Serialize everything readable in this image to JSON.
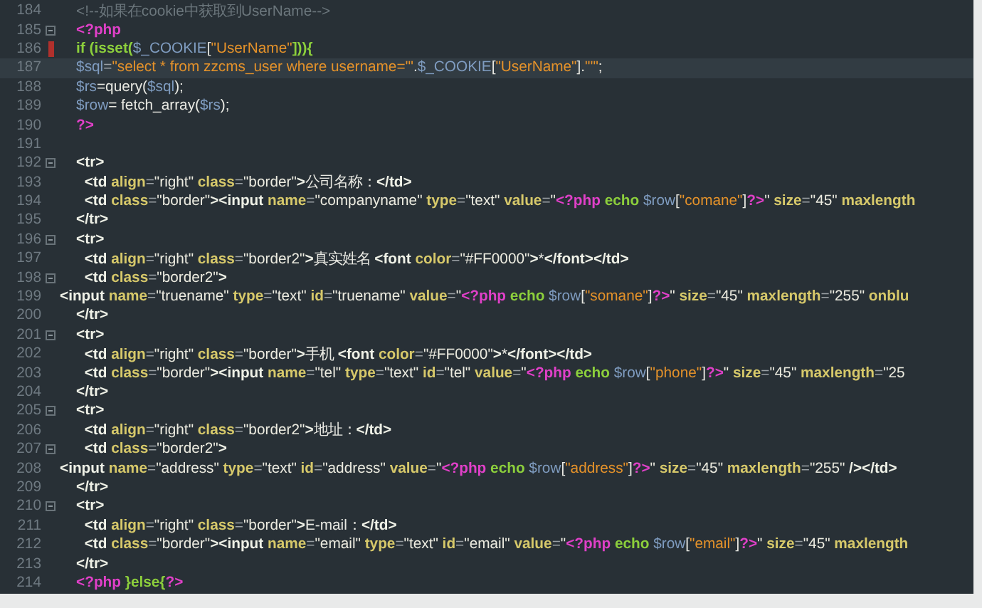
{
  "editor": {
    "lines": [
      {
        "number": "184",
        "fold": false,
        "marker": false,
        "current": false,
        "tokens": [
          {
            "kind": "comment",
            "text": "    <!--如果在cookie中获取到UserName-->"
          }
        ]
      },
      {
        "number": "185",
        "fold": true,
        "marker": false,
        "current": false,
        "tokens": [
          {
            "kind": "php",
            "text": "    <?php"
          }
        ]
      },
      {
        "number": "186",
        "fold": false,
        "marker": true,
        "current": false,
        "tokens": [
          {
            "kind": "kw",
            "text": "    if (isset("
          },
          {
            "kind": "var",
            "text": "$_COOKIE"
          },
          {
            "kind": "plain",
            "text": "["
          },
          {
            "kind": "str",
            "text": "\"UserName\""
          },
          {
            "kind": "kw",
            "text": "])){"
          }
        ]
      },
      {
        "number": "187",
        "fold": false,
        "marker": false,
        "current": true,
        "tokens": [
          {
            "kind": "var",
            "text": "    $sql"
          },
          {
            "kind": "op",
            "text": "="
          },
          {
            "kind": "str",
            "text": "\"select * from zzcms_user where username='\""
          },
          {
            "kind": "plain",
            "text": "."
          },
          {
            "kind": "var",
            "text": "$_COOKIE"
          },
          {
            "kind": "plain",
            "text": "["
          },
          {
            "kind": "str",
            "text": "\"UserName\""
          },
          {
            "kind": "plain",
            "text": "]."
          },
          {
            "kind": "str",
            "text": "\"'\""
          },
          {
            "kind": "plain",
            "text": ";"
          }
        ]
      },
      {
        "number": "188",
        "fold": false,
        "marker": false,
        "current": false,
        "tokens": [
          {
            "kind": "var",
            "text": "    $rs"
          },
          {
            "kind": "plain",
            "text": "=query("
          },
          {
            "kind": "var",
            "text": "$sql"
          },
          {
            "kind": "plain",
            "text": ");"
          }
        ]
      },
      {
        "number": "189",
        "fold": false,
        "marker": false,
        "current": false,
        "tokens": [
          {
            "kind": "var",
            "text": "    $row"
          },
          {
            "kind": "plain",
            "text": "= fetch_array("
          },
          {
            "kind": "var",
            "text": "$rs"
          },
          {
            "kind": "plain",
            "text": ");"
          }
        ]
      },
      {
        "number": "190",
        "fold": false,
        "marker": false,
        "current": false,
        "tokens": [
          {
            "kind": "php",
            "text": "    ?>"
          }
        ]
      },
      {
        "number": "191",
        "fold": false,
        "marker": false,
        "current": false
      },
      {
        "number": "192",
        "fold": true,
        "marker": false,
        "current": false,
        "tokens": [
          {
            "kind": "tag",
            "text": "    <tr>"
          }
        ]
      },
      {
        "number": "193",
        "fold": false,
        "marker": false,
        "current": false,
        "tokens": [
          {
            "kind": "tag",
            "text": "      <td"
          },
          {
            "kind": "attr",
            "text": " align"
          },
          {
            "kind": "op",
            "text": "="
          },
          {
            "kind": "val",
            "text": "\"right\""
          },
          {
            "kind": "attr",
            "text": " class"
          },
          {
            "kind": "op",
            "text": "="
          },
          {
            "kind": "val",
            "text": "\"border\""
          },
          {
            "kind": "tag",
            "text": ">"
          },
          {
            "kind": "plain",
            "text": "公司名称："
          },
          {
            "kind": "tag",
            "text": "</td>"
          }
        ]
      },
      {
        "number": "194",
        "fold": false,
        "marker": false,
        "current": false,
        "tokens": [
          {
            "kind": "tag",
            "text": "      <td"
          },
          {
            "kind": "attr",
            "text": " class"
          },
          {
            "kind": "op",
            "text": "="
          },
          {
            "kind": "val",
            "text": "\"border\""
          },
          {
            "kind": "tag",
            "text": "><input"
          },
          {
            "kind": "attr",
            "text": " name"
          },
          {
            "kind": "op",
            "text": "="
          },
          {
            "kind": "val",
            "text": "\"companyname\""
          },
          {
            "kind": "attr",
            "text": " type"
          },
          {
            "kind": "op",
            "text": "="
          },
          {
            "kind": "val",
            "text": "\"text\""
          },
          {
            "kind": "attr",
            "text": " value"
          },
          {
            "kind": "op",
            "text": "="
          },
          {
            "kind": "val",
            "text": "\""
          },
          {
            "kind": "php",
            "text": "<?php"
          },
          {
            "kind": "kw",
            "text": " echo"
          },
          {
            "kind": "var",
            "text": " $row"
          },
          {
            "kind": "plain",
            "text": "["
          },
          {
            "kind": "str",
            "text": "\"comane\""
          },
          {
            "kind": "plain",
            "text": "]"
          },
          {
            "kind": "php",
            "text": "?>"
          },
          {
            "kind": "val",
            "text": "\""
          },
          {
            "kind": "attr",
            "text": " size"
          },
          {
            "kind": "op",
            "text": "="
          },
          {
            "kind": "val",
            "text": "\"45\""
          },
          {
            "kind": "attr",
            "text": " maxlength"
          }
        ]
      },
      {
        "number": "195",
        "fold": false,
        "marker": false,
        "current": false,
        "tokens": [
          {
            "kind": "tag",
            "text": "    </tr>"
          }
        ]
      },
      {
        "number": "196",
        "fold": true,
        "marker": false,
        "current": false,
        "tokens": [
          {
            "kind": "tag",
            "text": "    <tr>"
          }
        ]
      },
      {
        "number": "197",
        "fold": false,
        "marker": false,
        "current": false,
        "tokens": [
          {
            "kind": "tag",
            "text": "      <td"
          },
          {
            "kind": "attr",
            "text": " align"
          },
          {
            "kind": "op",
            "text": "="
          },
          {
            "kind": "val",
            "text": "\"right\""
          },
          {
            "kind": "attr",
            "text": " class"
          },
          {
            "kind": "op",
            "text": "="
          },
          {
            "kind": "val",
            "text": "\"border2\""
          },
          {
            "kind": "tag",
            "text": ">"
          },
          {
            "kind": "plain",
            "text": "真实姓名 "
          },
          {
            "kind": "tag",
            "text": "<font"
          },
          {
            "kind": "attr",
            "text": " color"
          },
          {
            "kind": "op",
            "text": "="
          },
          {
            "kind": "val",
            "text": "\"#FF0000\""
          },
          {
            "kind": "tag",
            "text": ">"
          },
          {
            "kind": "plain",
            "text": "*"
          },
          {
            "kind": "tag",
            "text": "</font></td>"
          }
        ]
      },
      {
        "number": "198",
        "fold": true,
        "marker": false,
        "current": false,
        "tokens": [
          {
            "kind": "tag",
            "text": "      <td"
          },
          {
            "kind": "attr",
            "text": " class"
          },
          {
            "kind": "op",
            "text": "="
          },
          {
            "kind": "val",
            "text": "\"border2\""
          },
          {
            "kind": "tag",
            "text": ">"
          }
        ]
      },
      {
        "number": "199",
        "fold": false,
        "marker": false,
        "current": false,
        "tokens": [
          {
            "kind": "tag",
            "text": "<input"
          },
          {
            "kind": "attr",
            "text": " name"
          },
          {
            "kind": "op",
            "text": "="
          },
          {
            "kind": "val",
            "text": "\"truename\""
          },
          {
            "kind": "attr",
            "text": " type"
          },
          {
            "kind": "op",
            "text": "="
          },
          {
            "kind": "val",
            "text": "\"text\""
          },
          {
            "kind": "attr",
            "text": " id"
          },
          {
            "kind": "op",
            "text": "="
          },
          {
            "kind": "val",
            "text": "\"truename\""
          },
          {
            "kind": "attr",
            "text": " value"
          },
          {
            "kind": "op",
            "text": "="
          },
          {
            "kind": "val",
            "text": "\""
          },
          {
            "kind": "php",
            "text": "<?php"
          },
          {
            "kind": "kw",
            "text": " echo"
          },
          {
            "kind": "var",
            "text": " $row"
          },
          {
            "kind": "plain",
            "text": "["
          },
          {
            "kind": "str",
            "text": "\"somane\""
          },
          {
            "kind": "plain",
            "text": "]"
          },
          {
            "kind": "php",
            "text": "?>"
          },
          {
            "kind": "val",
            "text": "\""
          },
          {
            "kind": "attr",
            "text": " size"
          },
          {
            "kind": "op",
            "text": "="
          },
          {
            "kind": "val",
            "text": "\"45\""
          },
          {
            "kind": "attr",
            "text": " maxlength"
          },
          {
            "kind": "op",
            "text": "="
          },
          {
            "kind": "val",
            "text": "\"255\""
          },
          {
            "kind": "attr",
            "text": " onblu"
          }
        ]
      },
      {
        "number": "200",
        "fold": false,
        "marker": false,
        "current": false,
        "tokens": [
          {
            "kind": "tag",
            "text": "    </tr>"
          }
        ]
      },
      {
        "number": "201",
        "fold": true,
        "marker": false,
        "current": false,
        "tokens": [
          {
            "kind": "tag",
            "text": "    <tr>"
          }
        ]
      },
      {
        "number": "202",
        "fold": false,
        "marker": false,
        "current": false,
        "tokens": [
          {
            "kind": "tag",
            "text": "      <td"
          },
          {
            "kind": "attr",
            "text": " align"
          },
          {
            "kind": "op",
            "text": "="
          },
          {
            "kind": "val",
            "text": "\"right\""
          },
          {
            "kind": "attr",
            "text": " class"
          },
          {
            "kind": "op",
            "text": "="
          },
          {
            "kind": "val",
            "text": "\"border\""
          },
          {
            "kind": "tag",
            "text": ">"
          },
          {
            "kind": "plain",
            "text": "手机 "
          },
          {
            "kind": "tag",
            "text": "<font"
          },
          {
            "kind": "attr",
            "text": " color"
          },
          {
            "kind": "op",
            "text": "="
          },
          {
            "kind": "val",
            "text": "\"#FF0000\""
          },
          {
            "kind": "tag",
            "text": ">"
          },
          {
            "kind": "plain",
            "text": "*"
          },
          {
            "kind": "tag",
            "text": "</font></td>"
          }
        ]
      },
      {
        "number": "203",
        "fold": false,
        "marker": false,
        "current": false,
        "tokens": [
          {
            "kind": "tag",
            "text": "      <td"
          },
          {
            "kind": "attr",
            "text": " class"
          },
          {
            "kind": "op",
            "text": "="
          },
          {
            "kind": "val",
            "text": "\"border\""
          },
          {
            "kind": "tag",
            "text": "><input"
          },
          {
            "kind": "attr",
            "text": " name"
          },
          {
            "kind": "op",
            "text": "="
          },
          {
            "kind": "val",
            "text": "\"tel\""
          },
          {
            "kind": "attr",
            "text": " type"
          },
          {
            "kind": "op",
            "text": "="
          },
          {
            "kind": "val",
            "text": "\"text\""
          },
          {
            "kind": "attr",
            "text": " id"
          },
          {
            "kind": "op",
            "text": "="
          },
          {
            "kind": "val",
            "text": "\"tel\""
          },
          {
            "kind": "attr",
            "text": " value"
          },
          {
            "kind": "op",
            "text": "="
          },
          {
            "kind": "val",
            "text": "\""
          },
          {
            "kind": "php",
            "text": "<?php"
          },
          {
            "kind": "kw",
            "text": " echo"
          },
          {
            "kind": "var",
            "text": " $row"
          },
          {
            "kind": "plain",
            "text": "["
          },
          {
            "kind": "str",
            "text": "\"phone\""
          },
          {
            "kind": "plain",
            "text": "]"
          },
          {
            "kind": "php",
            "text": "?>"
          },
          {
            "kind": "val",
            "text": "\""
          },
          {
            "kind": "attr",
            "text": " size"
          },
          {
            "kind": "op",
            "text": "="
          },
          {
            "kind": "val",
            "text": "\"45\""
          },
          {
            "kind": "attr",
            "text": " maxlength"
          },
          {
            "kind": "op",
            "text": "="
          },
          {
            "kind": "val",
            "text": "\"25"
          }
        ]
      },
      {
        "number": "204",
        "fold": false,
        "marker": false,
        "current": false,
        "tokens": [
          {
            "kind": "tag",
            "text": "    </tr>"
          }
        ]
      },
      {
        "number": "205",
        "fold": true,
        "marker": false,
        "current": false,
        "tokens": [
          {
            "kind": "tag",
            "text": "    <tr>"
          }
        ]
      },
      {
        "number": "206",
        "fold": false,
        "marker": false,
        "current": false,
        "tokens": [
          {
            "kind": "tag",
            "text": "      <td"
          },
          {
            "kind": "attr",
            "text": " align"
          },
          {
            "kind": "op",
            "text": "="
          },
          {
            "kind": "val",
            "text": "\"right\""
          },
          {
            "kind": "attr",
            "text": " class"
          },
          {
            "kind": "op",
            "text": "="
          },
          {
            "kind": "val",
            "text": "\"border2\""
          },
          {
            "kind": "tag",
            "text": ">"
          },
          {
            "kind": "plain",
            "text": "地址："
          },
          {
            "kind": "tag",
            "text": "</td>"
          }
        ]
      },
      {
        "number": "207",
        "fold": true,
        "marker": false,
        "current": false,
        "tokens": [
          {
            "kind": "tag",
            "text": "      <td"
          },
          {
            "kind": "attr",
            "text": " class"
          },
          {
            "kind": "op",
            "text": "="
          },
          {
            "kind": "val",
            "text": "\"border2\""
          },
          {
            "kind": "tag",
            "text": ">"
          }
        ]
      },
      {
        "number": "208",
        "fold": false,
        "marker": false,
        "current": false,
        "tokens": [
          {
            "kind": "tag",
            "text": "<input"
          },
          {
            "kind": "attr",
            "text": " name"
          },
          {
            "kind": "op",
            "text": "="
          },
          {
            "kind": "val",
            "text": "\"address\""
          },
          {
            "kind": "attr",
            "text": " type"
          },
          {
            "kind": "op",
            "text": "="
          },
          {
            "kind": "val",
            "text": "\"text\""
          },
          {
            "kind": "attr",
            "text": " id"
          },
          {
            "kind": "op",
            "text": "="
          },
          {
            "kind": "val",
            "text": "\"address\""
          },
          {
            "kind": "attr",
            "text": " value"
          },
          {
            "kind": "op",
            "text": "="
          },
          {
            "kind": "val",
            "text": "\""
          },
          {
            "kind": "php",
            "text": "<?php"
          },
          {
            "kind": "kw",
            "text": " echo"
          },
          {
            "kind": "var",
            "text": " $row"
          },
          {
            "kind": "plain",
            "text": "["
          },
          {
            "kind": "str",
            "text": "\"address\""
          },
          {
            "kind": "plain",
            "text": "]"
          },
          {
            "kind": "php",
            "text": "?>"
          },
          {
            "kind": "val",
            "text": "\""
          },
          {
            "kind": "attr",
            "text": " size"
          },
          {
            "kind": "op",
            "text": "="
          },
          {
            "kind": "val",
            "text": "\"45\""
          },
          {
            "kind": "attr",
            "text": " maxlength"
          },
          {
            "kind": "op",
            "text": "="
          },
          {
            "kind": "val",
            "text": "\"255\""
          },
          {
            "kind": "tag",
            "text": " /></td>"
          }
        ]
      },
      {
        "number": "209",
        "fold": false,
        "marker": false,
        "current": false,
        "tokens": [
          {
            "kind": "tag",
            "text": "    </tr>"
          }
        ]
      },
      {
        "number": "210",
        "fold": true,
        "marker": false,
        "current": false,
        "tokens": [
          {
            "kind": "tag",
            "text": "    <tr>"
          }
        ]
      },
      {
        "number": "211",
        "fold": false,
        "marker": false,
        "current": false,
        "tokens": [
          {
            "kind": "tag",
            "text": "      <td"
          },
          {
            "kind": "attr",
            "text": " align"
          },
          {
            "kind": "op",
            "text": "="
          },
          {
            "kind": "val",
            "text": "\"right\""
          },
          {
            "kind": "attr",
            "text": " class"
          },
          {
            "kind": "op",
            "text": "="
          },
          {
            "kind": "val",
            "text": "\"border\""
          },
          {
            "kind": "tag",
            "text": ">"
          },
          {
            "kind": "plain",
            "text": "E-mail："
          },
          {
            "kind": "tag",
            "text": "</td>"
          }
        ]
      },
      {
        "number": "212",
        "fold": false,
        "marker": false,
        "current": false,
        "tokens": [
          {
            "kind": "tag",
            "text": "      <td"
          },
          {
            "kind": "attr",
            "text": " class"
          },
          {
            "kind": "op",
            "text": "="
          },
          {
            "kind": "val",
            "text": "\"border\""
          },
          {
            "kind": "tag",
            "text": "><input"
          },
          {
            "kind": "attr",
            "text": " name"
          },
          {
            "kind": "op",
            "text": "="
          },
          {
            "kind": "val",
            "text": "\"email\""
          },
          {
            "kind": "attr",
            "text": " type"
          },
          {
            "kind": "op",
            "text": "="
          },
          {
            "kind": "val",
            "text": "\"text\""
          },
          {
            "kind": "attr",
            "text": " id"
          },
          {
            "kind": "op",
            "text": "="
          },
          {
            "kind": "val",
            "text": "\"email\""
          },
          {
            "kind": "attr",
            "text": " value"
          },
          {
            "kind": "op",
            "text": "="
          },
          {
            "kind": "val",
            "text": "\""
          },
          {
            "kind": "php",
            "text": "<?php"
          },
          {
            "kind": "kw",
            "text": " echo"
          },
          {
            "kind": "var",
            "text": " $row"
          },
          {
            "kind": "plain",
            "text": "["
          },
          {
            "kind": "str",
            "text": "\"email\""
          },
          {
            "kind": "plain",
            "text": "]"
          },
          {
            "kind": "php",
            "text": "?>"
          },
          {
            "kind": "val",
            "text": "\""
          },
          {
            "kind": "attr",
            "text": " size"
          },
          {
            "kind": "op",
            "text": "="
          },
          {
            "kind": "val",
            "text": "\"45\""
          },
          {
            "kind": "attr",
            "text": " maxlength"
          }
        ]
      },
      {
        "number": "213",
        "fold": false,
        "marker": false,
        "current": false,
        "tokens": [
          {
            "kind": "tag",
            "text": "    </tr>"
          }
        ]
      },
      {
        "number": "214",
        "fold": false,
        "marker": false,
        "current": false,
        "tokens": [
          {
            "kind": "php",
            "text": "    <?php"
          },
          {
            "kind": "kw",
            "text": " }else{"
          },
          {
            "kind": "php",
            "text": "?>"
          }
        ]
      }
    ]
  }
}
